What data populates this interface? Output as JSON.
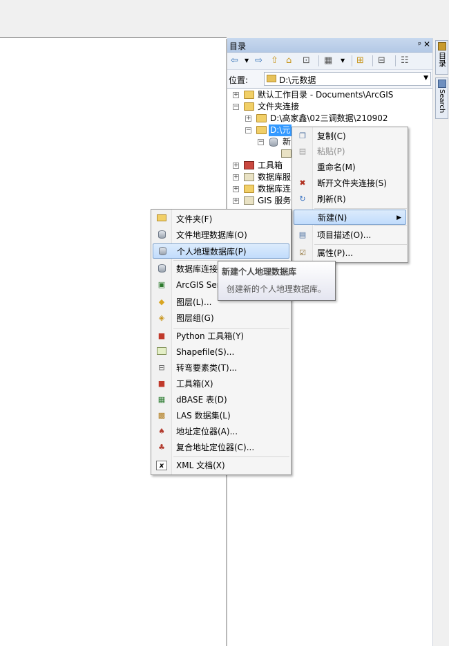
{
  "catalog": {
    "title": "目录",
    "pin": "ᵖ",
    "close": "✕",
    "location_label": "位置:",
    "location_value": "D:\\元数据",
    "tree": [
      {
        "label": "默认工作目录 - Documents\\ArcGIS",
        "icon": "home-folder-icon",
        "expander": "+"
      },
      {
        "label": "文件夹连接",
        "icon": "folder-connections-icon",
        "expander": "−"
      },
      {
        "label": "D:\\高家鑫\\02三调数据\\210902",
        "icon": "folder-icon",
        "expander": "+"
      },
      {
        "label": "D:\\元",
        "icon": "folder-icon",
        "expander": "−"
      },
      {
        "label": "新",
        "icon": "database-icon",
        "expander": "−"
      },
      {
        "label": "工具箱",
        "icon": "toolbox-icon",
        "expander": "+"
      },
      {
        "label": "数据库服",
        "icon": "database-server-icon",
        "expander": "+"
      },
      {
        "label": "数据库连",
        "icon": "database-connections-icon",
        "expander": "+"
      },
      {
        "label": "GIS 服务",
        "icon": "gis-server-icon",
        "expander": "+"
      }
    ]
  },
  "side_tabs": {
    "catalog": "目录",
    "search": "Search"
  },
  "context_menu": {
    "items": [
      {
        "label": "复制(C)",
        "icon": "copy-icon"
      },
      {
        "label": "粘贴(P)",
        "icon": "paste-icon",
        "disabled": true
      },
      {
        "label": "重命名(M)"
      },
      {
        "label": "断开文件夹连接(S)",
        "icon": "disconnect-folder-icon"
      },
      {
        "label": "刷新(R)",
        "icon": "refresh-icon"
      },
      {
        "label": "新建(N)",
        "submenu": true,
        "highlighted": true
      },
      {
        "label": "项目描述(O)...",
        "icon": "item-description-icon"
      },
      {
        "label": "属性(P)...",
        "icon": "properties-icon"
      }
    ]
  },
  "new_submenu": {
    "items": [
      {
        "label": "文件夹(F)",
        "icon": "folder-icon"
      },
      {
        "label": "文件地理数据库(O)",
        "icon": "file-geodatabase-icon"
      },
      {
        "label": "个人地理数据库(P)",
        "icon": "personal-geodatabase-icon",
        "highlighted": true
      },
      {
        "label": "数据库连接",
        "icon": "database-connection-icon"
      },
      {
        "label": "ArcGIS Ser",
        "icon": "arcgis-server-icon"
      },
      {
        "label": "图层(L)...",
        "icon": "layer-icon"
      },
      {
        "label": "图层组(G)",
        "icon": "group-layer-icon"
      },
      {
        "label": "Python 工具箱(Y)",
        "icon": "python-toolbox-icon"
      },
      {
        "label": "Shapefile(S)...",
        "icon": "shapefile-icon"
      },
      {
        "label": "转弯要素类(T)...",
        "icon": "turn-feature-class-icon"
      },
      {
        "label": "工具箱(X)",
        "icon": "toolbox-icon"
      },
      {
        "label": "dBASE 表(D)",
        "icon": "dbase-table-icon"
      },
      {
        "label": "LAS 数据集(L)",
        "icon": "las-dataset-icon"
      },
      {
        "label": "地址定位器(A)...",
        "icon": "address-locator-icon"
      },
      {
        "label": "复合地址定位器(C)...",
        "icon": "composite-locator-icon"
      },
      {
        "label": "XML 文档(X)",
        "icon": "xml-document-icon"
      }
    ]
  },
  "tooltip": {
    "title": "新建个人地理数据库",
    "description": "创建新的个人地理数据库。"
  }
}
